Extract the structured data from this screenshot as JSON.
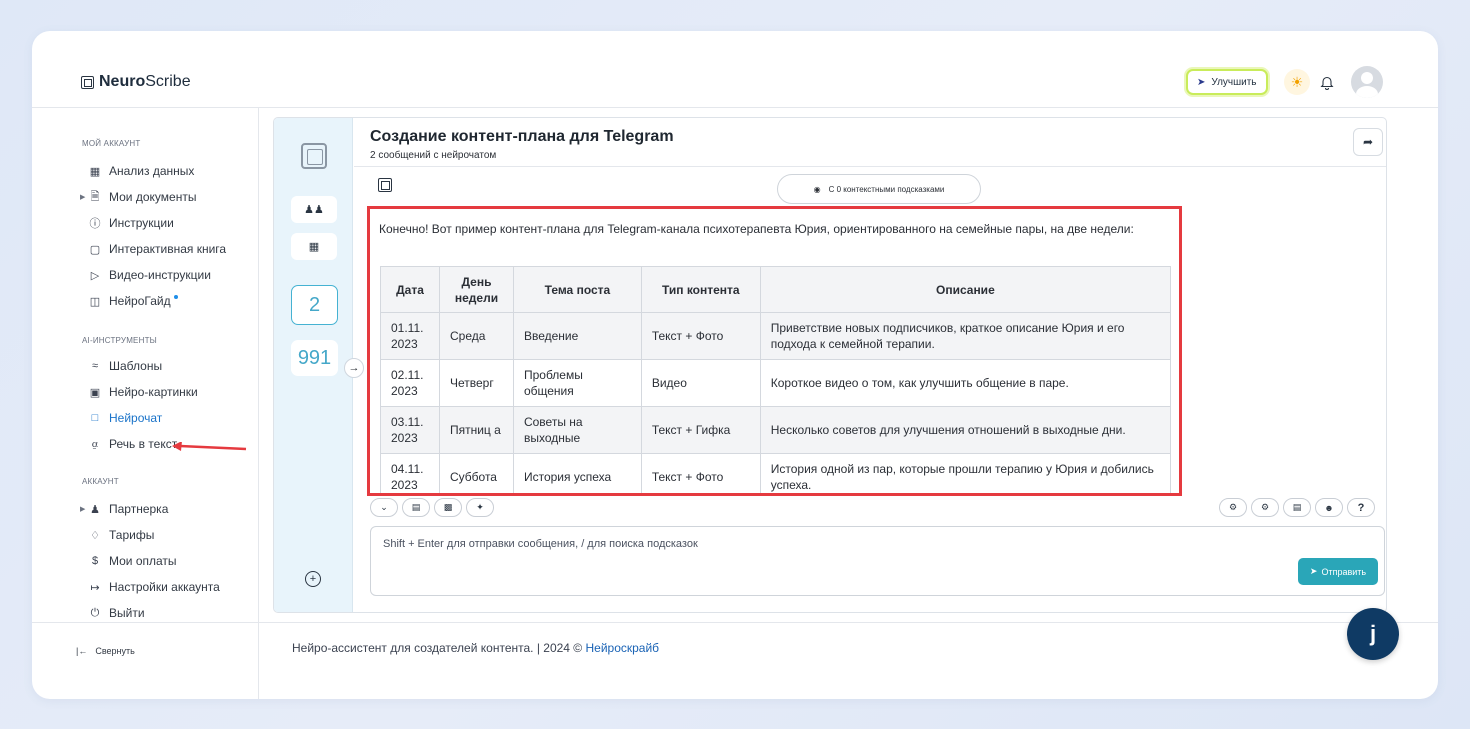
{
  "brand": {
    "name_bold": "Neuro",
    "name_rest": "Scribe"
  },
  "header": {
    "upgrade_label": "Улучшить"
  },
  "sidebar": {
    "sections": [
      {
        "title": "МОЙ АККАУНТ"
      },
      {
        "title": "AI-ИНСТРУМЕНТЫ"
      },
      {
        "title": "АККАУНТ"
      }
    ],
    "items": [
      {
        "label": "Анализ данных"
      },
      {
        "label": "Мои документы"
      },
      {
        "label": "Инструкции"
      },
      {
        "label": "Интерактивная книга"
      },
      {
        "label": "Видео-инструкции"
      },
      {
        "label": "НейроГайд"
      },
      {
        "label": "Шаблоны"
      },
      {
        "label": "Нейро-картинки"
      },
      {
        "label": "Нейрочат"
      },
      {
        "label": "Речь в текст"
      },
      {
        "label": "Партнерка"
      },
      {
        "label": "Тарифы"
      },
      {
        "label": "Мои оплаты"
      },
      {
        "label": "Настройки аккаунта"
      },
      {
        "label": "Выйти"
      }
    ],
    "collapse_label": "Свернуть"
  },
  "rail": {
    "count_boxed": "2",
    "count_plain": "991"
  },
  "chat": {
    "title": "Создание контент-плана для Telegram",
    "subtitle": "2 сообщений с нейрочатом",
    "context_pill": "С 0 контекстными подсказками",
    "answer_intro": "Конечно! Вот пример контент-плана для Telegram-канала психотерапевта Юрия, ориентированного на семейные пары, на две недели:",
    "table": {
      "headers": [
        "Дата",
        "День недели",
        "Тема поста",
        "Тип контента",
        "Описание"
      ],
      "rows": [
        [
          "01.11. 2023",
          "Среда",
          "Введение",
          "Текст + Фото",
          "Приветствие новых подписчиков, краткое описание Юрия и его подхода к семейной терапии."
        ],
        [
          "02.11. 2023",
          "Четверг",
          "Проблемы общения",
          "Видео",
          "Короткое видео о том, как улучшить общение в паре."
        ],
        [
          "03.11. 2023",
          "Пятниц а",
          "Советы на выходные",
          "Текст + Гифка",
          "Несколько советов для улучшения отношений в выходные дни."
        ],
        [
          "04.11. 2023",
          "Суббота",
          "История успеха",
          "Текст + Фото",
          "История одной из пар, которые прошли терапию у Юрия и добились успеха."
        ]
      ]
    },
    "input_placeholder": "Shift + Enter для отправки сообщения, / для поиска подсказок",
    "send_label": "Отправить"
  },
  "footer": {
    "text": "Нейро-ассистент для создателей контента.  | 2024 © ",
    "link": "Нейроскрайб"
  },
  "colors": {
    "accent": "#2aa6b8",
    "highlight_border": "#e53a3f",
    "rail_bg": "#e8f4fb",
    "upgrade_border": "#c9ec5a"
  }
}
